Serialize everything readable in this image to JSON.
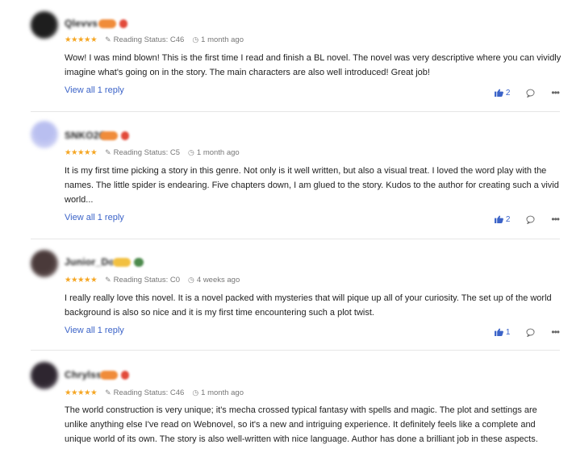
{
  "reviews": [
    {
      "username": "Qlevvs",
      "badge_colors": [
        "#f08c3a",
        "#e24a3a"
      ],
      "avatar_color": "#2b2b2b",
      "stars": "★★★★★",
      "reading_status": "Reading Status: C46",
      "time": "1 month ago",
      "body": "Wow! I was mind blown! This is the first time I read and finish a BL novel. The novel was very descriptive where you can vividly imagine what's going on in the story. The main characters are also well introduced! Great job!",
      "reply_label": "View all 1 reply",
      "likes": "2"
    },
    {
      "username": "SNKO26",
      "badge_colors": [
        "#f08c3a",
        "#e24a3a"
      ],
      "avatar_color": "#c9cdf2",
      "stars": "★★★★★",
      "reading_status": "Reading Status: C5",
      "time": "1 month ago",
      "body": "It is my first time picking a story in this genre. Not only is it well written, but also a visual treat. I loved the word play with the names. The little spider is endearing. Five chapters down, I am glued to the story. Kudos to the author for creating such a vivid world...",
      "reply_label": "View all 1 reply",
      "likes": "2"
    },
    {
      "username": "Junior_Do",
      "badge_colors": [
        "#f2c040",
        "#4c8a4c"
      ],
      "avatar_color": "#5a4a4a",
      "stars": "★★★★★",
      "reading_status": "Reading Status: C0",
      "time": "4 weeks ago",
      "body": "I really really love this novel. It is a novel packed with mysteries that will pique up all of your curiosity. The set up of the world background is also so nice and it is my first time encountering such a plot twist.",
      "reply_label": "View all 1 reply",
      "likes": "1"
    },
    {
      "username": "Chrylss",
      "badge_colors": [
        "#f08c3a",
        "#e24a3a"
      ],
      "avatar_color": "#3a2f3a",
      "stars": "★★★★★",
      "reading_status": "Reading Status: C46",
      "time": "1 month ago",
      "body": "The world construction is very unique; it's mecha crossed typical fantasy with spells and magic. The plot and settings are unlike anything else I've read on Webnovel, so it's a new and intriguing experience. It definitely feels like a complete and unique world of its own. The story is also well-written with nice language. Author has done a brilliant job in these aspects.",
      "reply_label": "",
      "likes": ""
    }
  ],
  "icons": {
    "status": "pencil-icon",
    "time": "clock-icon",
    "like": "thumbs-up-icon",
    "comment": "comment-bubble-icon",
    "more": "more-dots-icon"
  },
  "colors": {
    "accent": "#3b63c8",
    "star": "#f5a623"
  }
}
